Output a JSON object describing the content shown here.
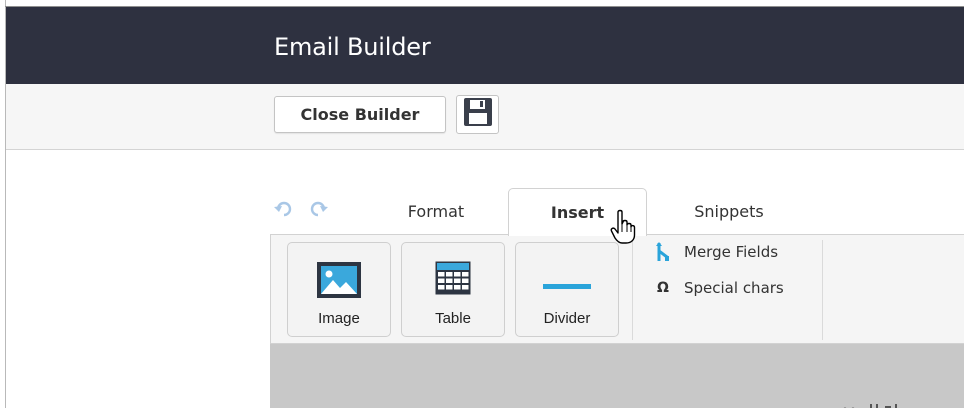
{
  "window": {
    "title": "Email Builder"
  },
  "toolbar": {
    "close_label": "Close Builder"
  },
  "icons": {
    "save": "floppy-disk-icon",
    "undo": "undo-icon",
    "redo": "redo-icon",
    "image": "image-icon",
    "table": "table-icon",
    "divider": "divider-icon",
    "merge": "merge-fields-icon",
    "special_chars": "omega-icon",
    "cursor": "hand-pointer-cursor"
  },
  "tabs": [
    {
      "label": "Format",
      "active": false
    },
    {
      "label": "Insert",
      "active": true
    },
    {
      "label": "Snippets",
      "active": false
    }
  ],
  "insert_panel": {
    "buttons": [
      {
        "label": "Image"
      },
      {
        "label": "Table"
      },
      {
        "label": "Divider"
      }
    ],
    "side_items": [
      {
        "label": "Merge Fields"
      },
      {
        "label": "Special chars",
        "glyph": "Ω"
      }
    ]
  },
  "colors": {
    "titlebar_bg": "#2e3140",
    "accent_blue": "#2aa4da",
    "canvas_bg": "#c8c8c8"
  }
}
